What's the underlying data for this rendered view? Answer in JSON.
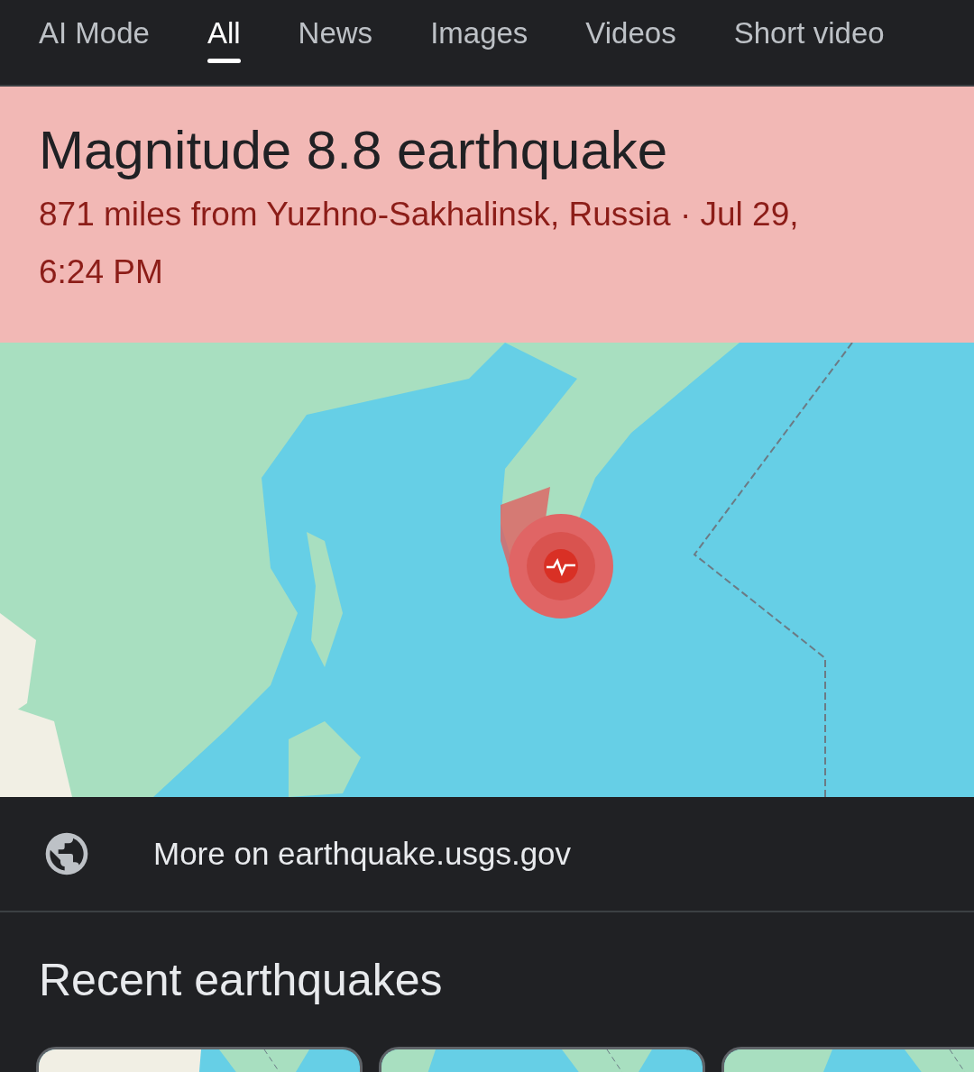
{
  "tabs": [
    {
      "label": "AI Mode",
      "selected": false
    },
    {
      "label": "All",
      "selected": true
    },
    {
      "label": "News",
      "selected": false
    },
    {
      "label": "Images",
      "selected": false
    },
    {
      "label": "Videos",
      "selected": false
    },
    {
      "label": "Short video",
      "selected": false
    }
  ],
  "alert": {
    "title": "Magnitude 8.8 earthquake",
    "subtitle": "871 miles from Yuzhno-Sakhalinsk, Russia · Jul 29, 6:24 PM"
  },
  "source_link": {
    "label": "More on earthquake.usgs.gov"
  },
  "recent": {
    "heading": "Recent earthquakes"
  }
}
